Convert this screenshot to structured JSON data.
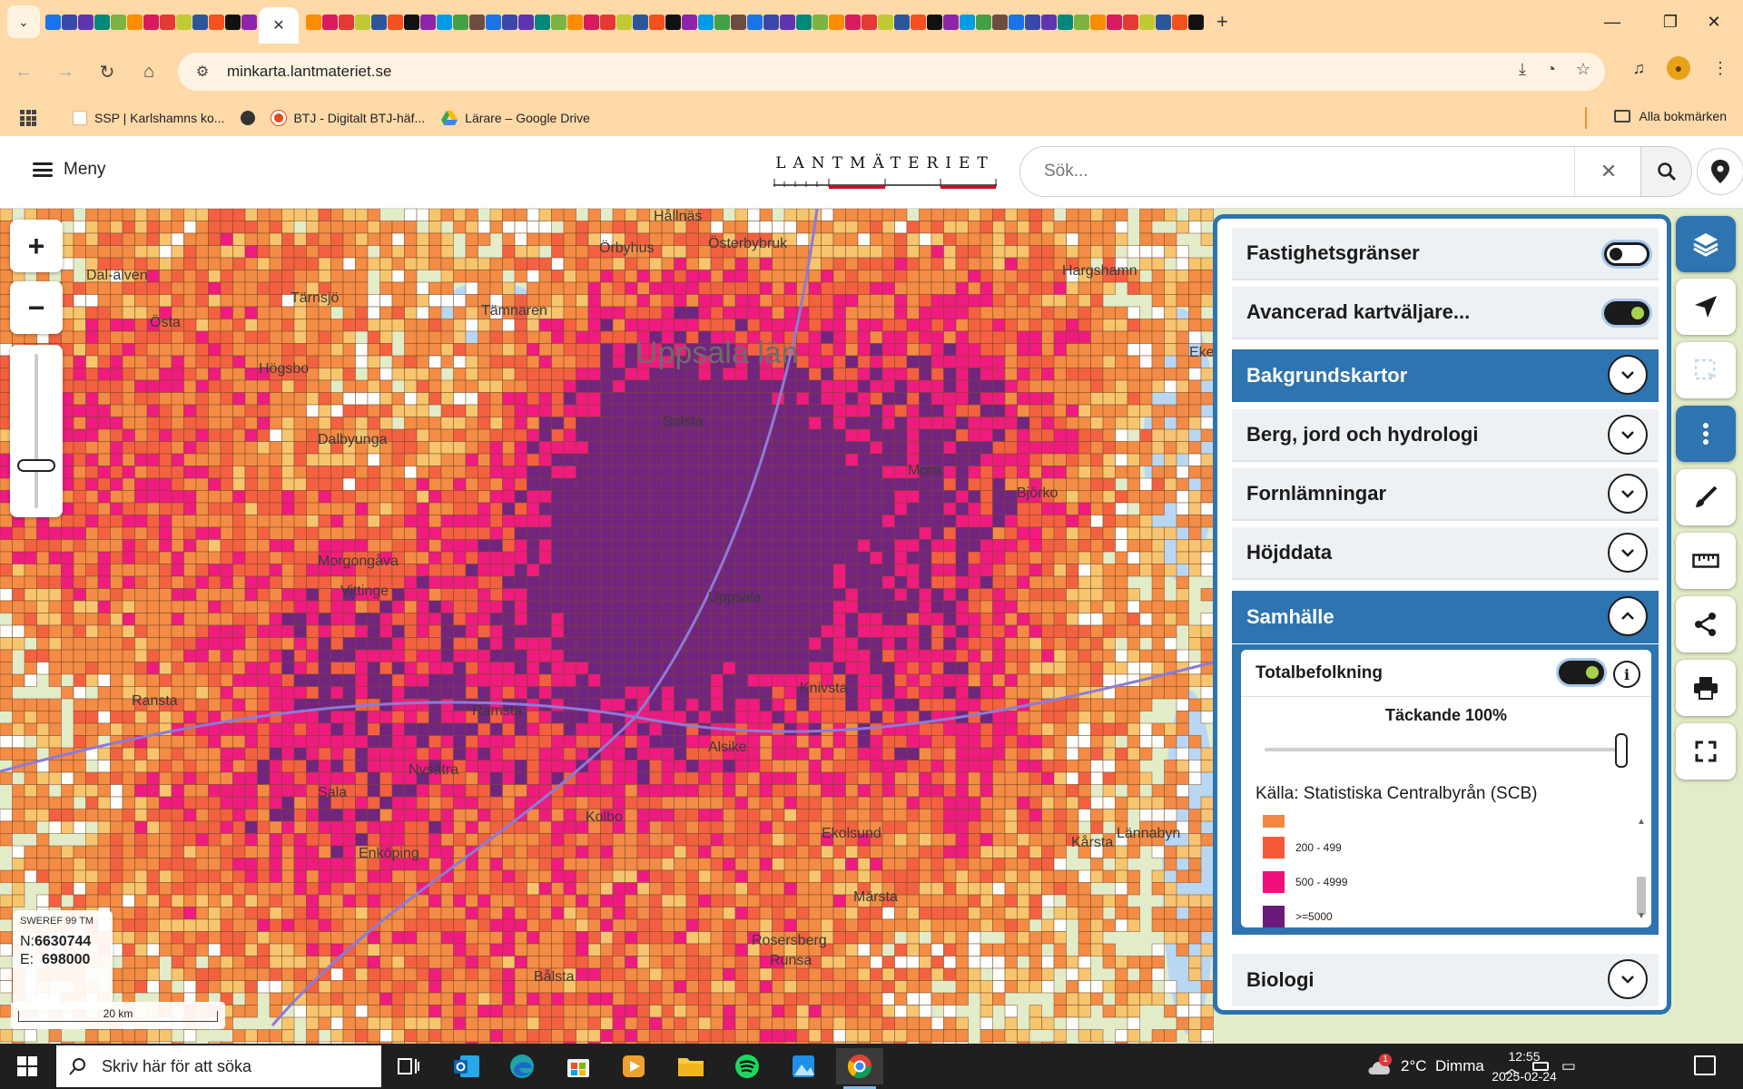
{
  "browser": {
    "url": "minkarta.lantmateriet.se",
    "bookmarks": [
      {
        "label": "SSP | Karlshamns ko...",
        "icon": "page-icon"
      },
      {
        "label": "",
        "icon": "globe-icon"
      },
      {
        "label": "BTJ - Digitalt BTJ-häf...",
        "icon": "btj-icon"
      },
      {
        "label": "Lärare – Google Drive",
        "icon": "drive-icon"
      }
    ],
    "all_bookmarks": "Alla bokmärken"
  },
  "app": {
    "menu_label": "Meny",
    "logo_text": "LANTMÄTERIET",
    "search": {
      "placeholder": "Sök..."
    }
  },
  "map": {
    "labels": [
      {
        "text": "Uppsala län",
        "big": true
      },
      {
        "text": "Ekeby"
      },
      {
        "text": "Salsta"
      },
      {
        "text": "Tämnaren"
      },
      {
        "text": "Österbybruk"
      },
      {
        "text": "Hargshamn"
      },
      {
        "text": "Tärnsjö"
      },
      {
        "text": "Östa"
      },
      {
        "text": "Dal-älven"
      },
      {
        "text": "Hållnäs"
      },
      {
        "text": "Högsbo"
      },
      {
        "text": "Dalbyunga"
      },
      {
        "text": "Morgongåva"
      },
      {
        "text": "Vittinge"
      },
      {
        "text": "Uppsala"
      },
      {
        "text": "Alsike"
      },
      {
        "text": "Ransta"
      },
      {
        "text": "Enköping"
      },
      {
        "text": "Märsta"
      },
      {
        "text": "Rosersberg"
      },
      {
        "text": "Runsa"
      },
      {
        "text": "Bålsta"
      },
      {
        "text": "Knivsta"
      },
      {
        "text": "Lännabyn"
      },
      {
        "text": "Kårsta"
      },
      {
        "text": "Mora"
      },
      {
        "text": "Björko"
      },
      {
        "text": "Ramsta"
      },
      {
        "text": "Nysätra"
      },
      {
        "text": "Kolbo"
      },
      {
        "text": "Örbyhus"
      },
      {
        "text": "Ekolsund"
      },
      {
        "text": "Sala"
      }
    ],
    "coord": {
      "crs": "SWEREF 99 TM",
      "n_label": "N:",
      "n": "6630744",
      "e_label": "E:",
      "e": "698000"
    },
    "scale": "20 km"
  },
  "layers_panel": {
    "rows": [
      {
        "label": "Fastighetsgränser",
        "type": "toggle",
        "on": false
      },
      {
        "label": "Avancerad kartväljare...",
        "type": "toggle",
        "on": true
      },
      {
        "label": "Bakgrundskartor",
        "type": "group",
        "expanded": false,
        "highlight": true
      },
      {
        "label": "Berg, jord och hydrologi",
        "type": "group",
        "expanded": false
      },
      {
        "label": "Fornlämningar",
        "type": "group",
        "expanded": false
      },
      {
        "label": "Höjddata",
        "type": "group",
        "expanded": false
      },
      {
        "label": "Samhälle",
        "type": "group",
        "expanded": true,
        "highlight": true
      },
      {
        "label": "Biologi",
        "type": "group",
        "expanded": false
      }
    ],
    "samhalle": {
      "layer_name": "Totalbefolkning",
      "layer_on": true,
      "opacity_label": "Täckande 100%",
      "opacity": 1.0,
      "source": "Källa: Statistiska Centralbyrån (SCB)",
      "legend": [
        {
          "label": "",
          "color": "#f4873e"
        },
        {
          "label": "200 - 499",
          "color": "#f45a3a"
        },
        {
          "label": "500 - 4999",
          "color": "#f0107a"
        },
        {
          "label": ">=5000",
          "color": "#6a1a7a"
        }
      ]
    }
  },
  "tools": [
    {
      "name": "layers-tool",
      "active": true
    },
    {
      "name": "navigate-tool"
    },
    {
      "name": "select-area-tool",
      "disabled": true
    },
    {
      "name": "more-tool",
      "active": true
    },
    {
      "name": "draw-tool"
    },
    {
      "name": "measure-tool"
    },
    {
      "name": "share-tool"
    },
    {
      "name": "print-tool"
    },
    {
      "name": "fullscreen-tool"
    }
  ],
  "taskbar": {
    "search_placeholder": "Skriv här för att söka",
    "weather": "2°C  Dimma",
    "weather_badge": "1",
    "time": "12:55",
    "date": "2025-02-24"
  },
  "colors": {
    "accent": "#2d74b0",
    "chrome": "#ffd9a8",
    "pop_light": "#f9c36a",
    "pop_orange": "#f4873e",
    "pop_red": "#f45a3a",
    "pop_pink": "#f0107a",
    "pop_purple": "#6a1a7a"
  }
}
